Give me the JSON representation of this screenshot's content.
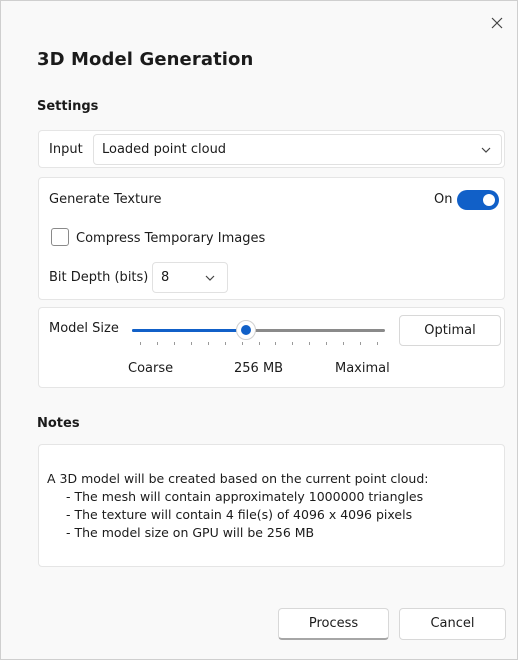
{
  "dialog": {
    "title": "3D Model Generation",
    "close_icon": "close-icon"
  },
  "settings": {
    "heading": "Settings",
    "input": {
      "label": "Input",
      "selected": "Loaded point cloud",
      "chevron_icon": "chevron-down-icon"
    },
    "texture": {
      "label": "Generate Texture",
      "toggle_state_label": "On",
      "toggle_on": true,
      "compress_label": "Compress Temporary Images",
      "compress_checked": false,
      "bit_depth_label": "Bit Depth (bits)",
      "bit_depth_value": "8"
    },
    "model_size": {
      "label": "Model Size",
      "slider_fraction": 0.45,
      "min_label": "Coarse",
      "value_label": "256 MB",
      "max_label": "Maximal",
      "optimal_button": "Optimal"
    }
  },
  "notes": {
    "heading": "Notes",
    "intro": "A 3D model will be created based on the current point cloud:",
    "items": [
      "- The mesh will contain approximately 1000000 triangles",
      "- The texture will contain 4 file(s) of 4096 x 4096 pixels",
      "- The model size on GPU will be 256 MB"
    ]
  },
  "footer": {
    "process_button": "Process",
    "cancel_button": "Cancel"
  },
  "colors": {
    "accent": "#1160c8",
    "panel_bg": "#ffffff",
    "dialog_bg": "#f9f9f9"
  }
}
